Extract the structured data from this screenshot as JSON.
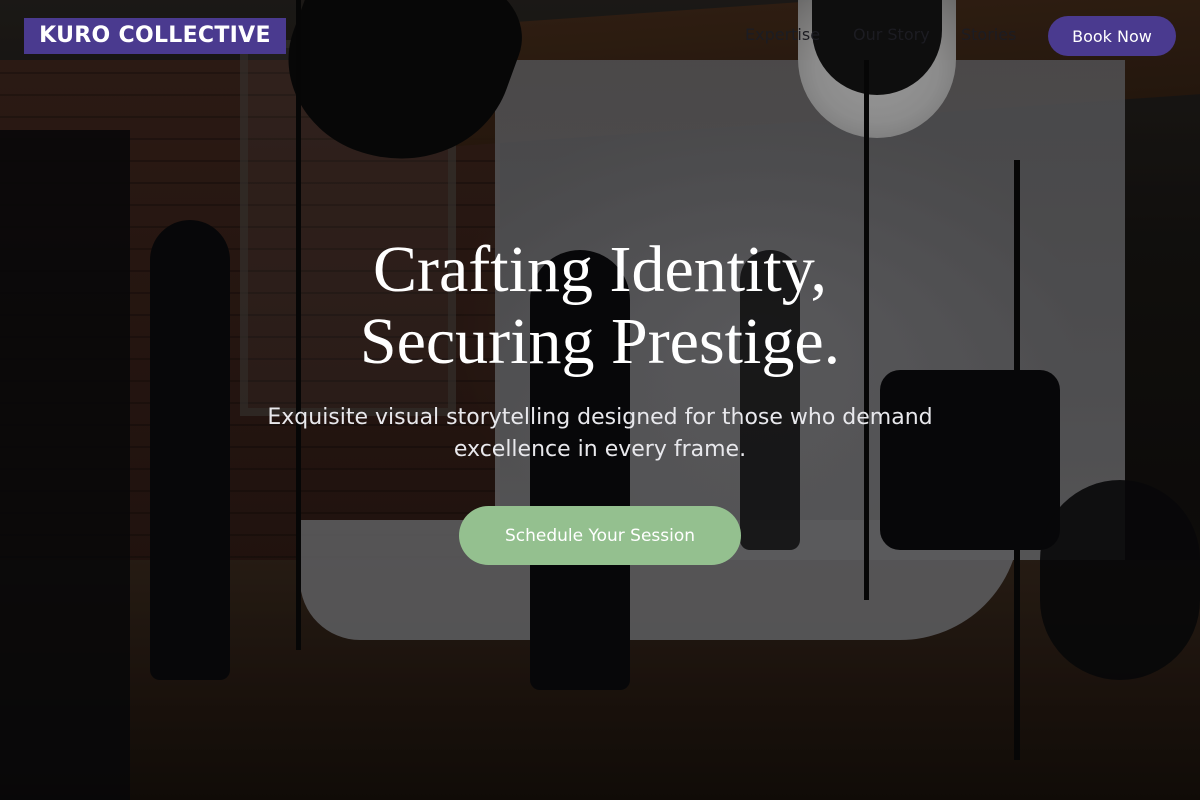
{
  "brand": {
    "logo_text": "KURO COLLECTIVE",
    "accent_color": "#4a3a8f"
  },
  "nav": {
    "links": [
      {
        "label": "Expertise"
      },
      {
        "label": "Our Story"
      },
      {
        "label": "Stories"
      }
    ],
    "book_label": "Book Now"
  },
  "hero": {
    "headline_line1": "Crafting Identity,",
    "headline_line2": "Securing Prestige.",
    "subheadline": "Exquisite visual storytelling designed for those who demand excellence in every frame.",
    "cta_label": "Schedule Your Session",
    "cta_color": "#94c08f",
    "background_image": "photo-studio-icon"
  }
}
